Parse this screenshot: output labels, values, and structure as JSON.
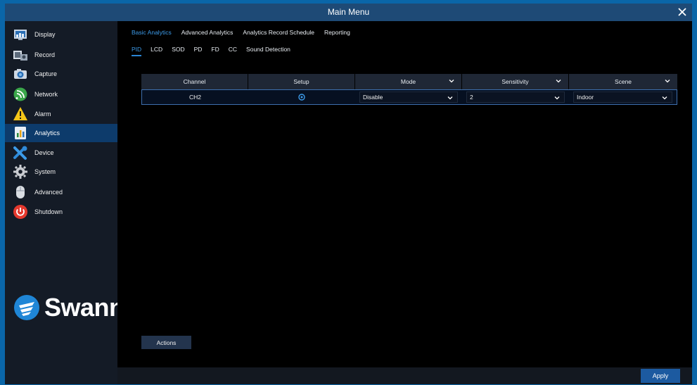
{
  "window": {
    "title": "Main Menu"
  },
  "sidebar": {
    "items": [
      {
        "label": "Display"
      },
      {
        "label": "Record"
      },
      {
        "label": "Capture"
      },
      {
        "label": "Network"
      },
      {
        "label": "Alarm"
      },
      {
        "label": "Analytics",
        "active": true
      },
      {
        "label": "Device"
      },
      {
        "label": "System"
      },
      {
        "label": "Advanced"
      },
      {
        "label": "Shutdown"
      }
    ]
  },
  "brand": {
    "name": "Swann"
  },
  "tabs": [
    {
      "label": "Basic Analytics",
      "active": true
    },
    {
      "label": "Advanced Analytics"
    },
    {
      "label": "Analytics Record Schedule"
    },
    {
      "label": "Reporting"
    }
  ],
  "subtabs": [
    {
      "label": "PID",
      "active": true
    },
    {
      "label": "LCD"
    },
    {
      "label": "SOD"
    },
    {
      "label": "PD"
    },
    {
      "label": "FD"
    },
    {
      "label": "CC"
    },
    {
      "label": "Sound Detection"
    }
  ],
  "table": {
    "headers": [
      "Channel",
      "Setup",
      "Mode",
      "Sensitivity",
      "Scene"
    ],
    "rows": [
      {
        "channel": "CH2",
        "mode": "Disable",
        "sensitivity": "2",
        "scene": "Indoor"
      }
    ]
  },
  "buttons": {
    "actions": "Actions",
    "apply": "Apply"
  },
  "colors": {
    "accent": "#3d9be9",
    "titlebar": "#1e4a76",
    "active_item": "#0d3b6b"
  }
}
